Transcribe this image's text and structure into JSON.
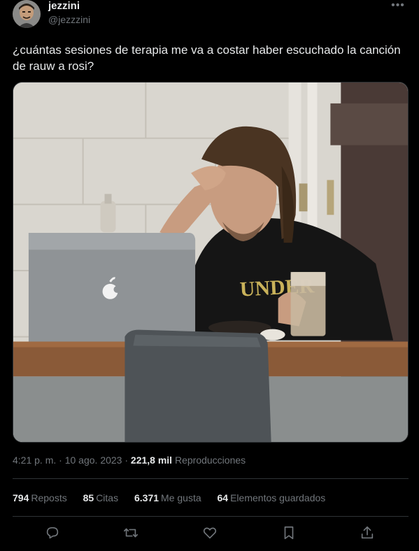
{
  "author": {
    "name": "jezzini",
    "handle": "@jezzzini",
    "avatar_icon": "profile-avatar"
  },
  "more_icon": "ellipsis-icon",
  "tweet": {
    "text": "¿cuántas sesiones de terapia me va a costar haber escuchado la canción de rauw a rosi?"
  },
  "media": {
    "image_icon": "photo-man-laptop-frustrated"
  },
  "meta": {
    "time": "4:21 p. m.",
    "separator": "·",
    "date": "10 ago. 2023",
    "views_count": "221,8 mil",
    "views_label": "Reproducciones"
  },
  "stats": [
    {
      "count": "794",
      "label": "Reposts"
    },
    {
      "count": "85",
      "label": "Citas"
    },
    {
      "count": "6.371",
      "label": "Me gusta"
    },
    {
      "count": "64",
      "label": "Elementos guardados"
    }
  ],
  "actions": [
    {
      "name": "reply",
      "icon": "reply-icon"
    },
    {
      "name": "repost",
      "icon": "repost-icon"
    },
    {
      "name": "like",
      "icon": "like-icon"
    },
    {
      "name": "bookmark",
      "icon": "bookmark-icon"
    },
    {
      "name": "share",
      "icon": "share-icon"
    }
  ],
  "colors": {
    "background": "#000000",
    "text_primary": "#e7e9ea",
    "text_secondary": "#71767b",
    "divider": "#2f3336"
  }
}
